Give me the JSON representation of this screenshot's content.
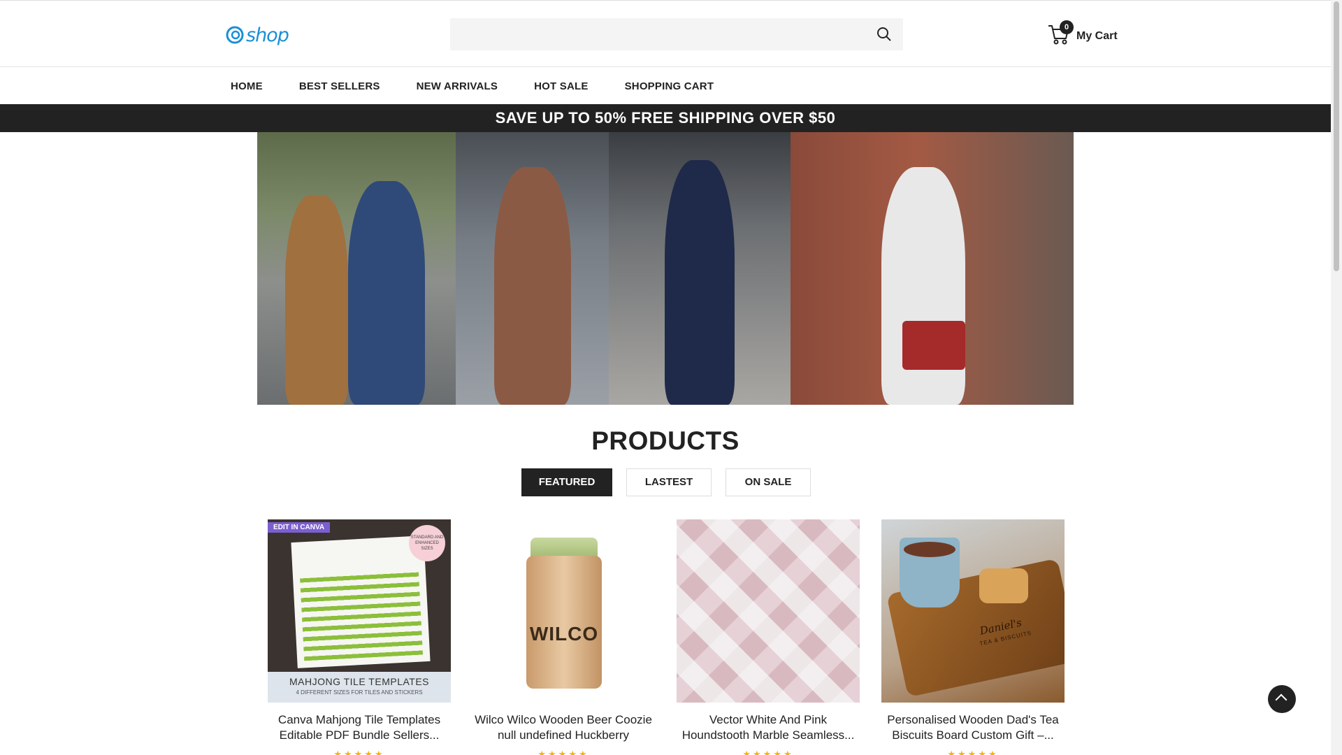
{
  "header": {
    "logo_text": "shop",
    "search_placeholder": "",
    "cart_count": "0",
    "cart_label": "My Cart"
  },
  "nav": {
    "items": [
      "HOME",
      "BEST SELLERS",
      "NEW ARRIVALS",
      "HOT SALE",
      "SHOPPING CART"
    ]
  },
  "promo": {
    "text": "SAVE UP TO 50% FREE SHIPPING OVER $50"
  },
  "products": {
    "title": "PRODUCTS",
    "tabs": [
      {
        "label": "FEATURED",
        "active": true
      },
      {
        "label": "LASTEST",
        "active": false
      },
      {
        "label": "ON SALE",
        "active": false
      }
    ],
    "items": [
      {
        "title": "Canva Mahjong Tile Templates Editable PDF Bundle Sellers...",
        "image_badge": "EDIT IN CANVA",
        "image_caption": "MAHJONG TILE TEMPLATES",
        "image_subcaption": "4 DIFFERENT SIZES FOR TILES AND STICKERS",
        "image_sticker": "STANDARD AND ENHANCED SIZES",
        "rating": "★★★★★"
      },
      {
        "title": "Wilco Wilco Wooden Beer Coozie null undefined Huckberry",
        "image_caption": "WILCO",
        "rating": "★★★★★"
      },
      {
        "title": "Vector White And Pink Houndstooth Marble Seamless...",
        "rating": "★★★★★"
      },
      {
        "title": "Personalised Wooden Dad's Tea Biscuits Board Custom Gift –...",
        "image_caption": "Daniel's",
        "image_subcaption": "TEA & BISCUITS",
        "rating": "★★★★★"
      }
    ]
  },
  "colors": {
    "accent": "#1a8fd6",
    "dark": "#222222",
    "promo_bg": "#222222",
    "star": "#f4b400"
  }
}
